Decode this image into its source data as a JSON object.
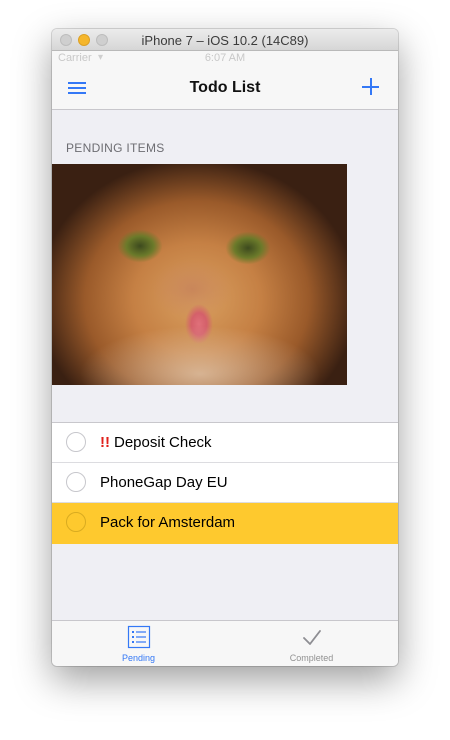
{
  "window": {
    "title": "iPhone 7 – iOS 10.2 (14C89)"
  },
  "status_bar": {
    "carrier": "Carrier",
    "time": "6:07 AM"
  },
  "nav": {
    "title": "Todo List"
  },
  "section": {
    "header": "PENDING ITEMS"
  },
  "items": [
    {
      "priority": "!!",
      "label": "Deposit Check",
      "highlighted": false
    },
    {
      "priority": "",
      "label": "PhoneGap Day EU",
      "highlighted": false
    },
    {
      "priority": "",
      "label": "Pack for Amsterdam",
      "highlighted": true
    }
  ],
  "tabs": [
    {
      "label": "Pending",
      "icon": "list-icon",
      "active": true
    },
    {
      "label": "Completed",
      "icon": "checkmark-icon",
      "active": false
    }
  ],
  "colors": {
    "accent": "#3478f6",
    "highlight": "#fec92e",
    "priority": "#e0201b",
    "background": "#efeff4"
  }
}
